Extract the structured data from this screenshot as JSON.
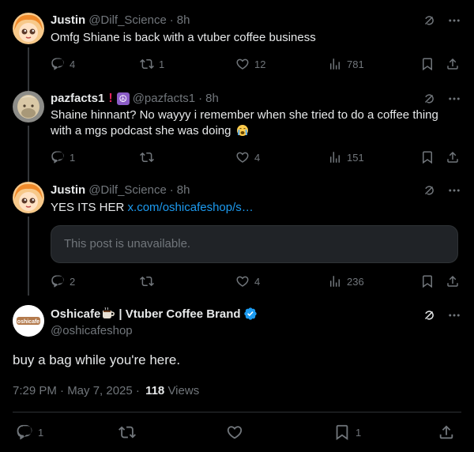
{
  "posts": [
    {
      "name": "Justin",
      "handle": "@Dilf_Science",
      "time": "8h",
      "text": "Omfg Shiane is back with a vtuber coffee business",
      "replies": "4",
      "reposts": "1",
      "likes": "12",
      "views": "781"
    },
    {
      "name": "pazfacts1",
      "handle": "@pazfacts1",
      "time": "8h",
      "text": "Shaine hinnant? No wayyy i remember when she tried to do a coffee thing with a mgs podcast she was doing",
      "replies": "1",
      "reposts": "",
      "likes": "4",
      "views": "151"
    },
    {
      "name": "Justin",
      "handle": "@Dilf_Science",
      "time": "8h",
      "text": "YES ITS HER",
      "link": "x.com/oshicafeshop/s…",
      "quote_unavailable": "This post is unavailable.",
      "replies": "2",
      "reposts": "",
      "likes": "4",
      "views": "236"
    }
  ],
  "main_post": {
    "name": "Oshicafe",
    "name_suffix": "| Vtuber Coffee Brand",
    "handle": "@oshicafeshop",
    "avatar_text": "oshicafe",
    "text": "buy a bag while you're here.",
    "timestamp": "7:29 PM · May 7, 2025 ·",
    "views_count": "118",
    "views_label": "Views",
    "replies": "1",
    "bookmarks": "1"
  },
  "colors": {
    "background": "#000000",
    "text": "#e7e9ea",
    "muted": "#71767b",
    "link": "#1d9bf0",
    "verified": "#1d9bf0"
  },
  "separator": "·"
}
